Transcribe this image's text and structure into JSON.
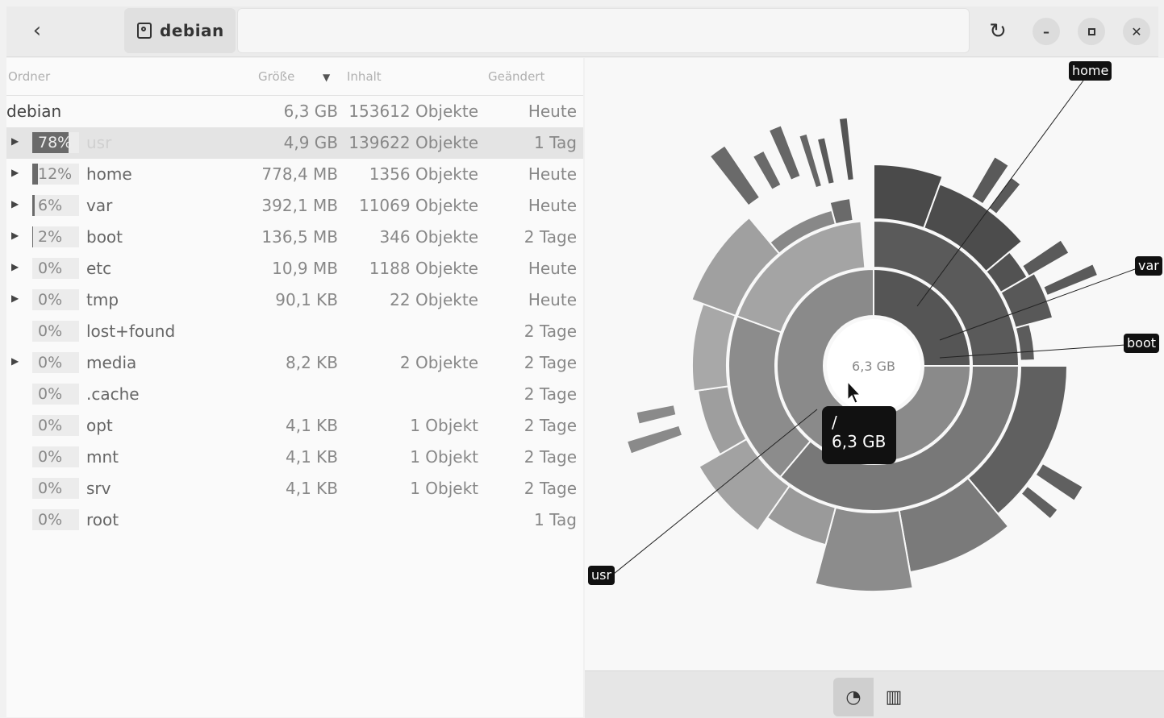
{
  "header": {
    "back_icon": "chevron-left-icon",
    "breadcrumb": "debian",
    "refresh_icon": "refresh-icon",
    "minimize_icon": "minimize-icon",
    "maximize_icon": "maximize-icon",
    "close_icon": "close-icon"
  },
  "columns": {
    "folder": "Ordner",
    "size": "Größe",
    "contents": "Inhalt",
    "modified": "Geändert"
  },
  "root": {
    "name": "debian",
    "size": "6,3 GB",
    "count": "153612 Objekte",
    "modified": "Heute"
  },
  "rows": [
    {
      "pct": "78%",
      "fill": 0.78,
      "name": "usr",
      "size": "4,9 GB",
      "count": "139622 Objekte",
      "modified": "1 Tag",
      "expandable": true,
      "selected": true
    },
    {
      "pct": "12%",
      "fill": 0.12,
      "name": "home",
      "size": "778,4 MB",
      "count": "1356 Objekte",
      "modified": "Heute",
      "expandable": true
    },
    {
      "pct": "6%",
      "fill": 0.06,
      "name": "var",
      "size": "392,1 MB",
      "count": "11069 Objekte",
      "modified": "Heute",
      "expandable": true
    },
    {
      "pct": "2%",
      "fill": 0.02,
      "name": "boot",
      "size": "136,5 MB",
      "count": "346 Objekte",
      "modified": "2 Tage",
      "expandable": true
    },
    {
      "pct": "0%",
      "fill": 0,
      "name": "etc",
      "size": "10,9 MB",
      "count": "1188 Objekte",
      "modified": "Heute",
      "expandable": true
    },
    {
      "pct": "0%",
      "fill": 0,
      "name": "tmp",
      "size": "90,1 KB",
      "count": "22 Objekte",
      "modified": "Heute",
      "expandable": true
    },
    {
      "pct": "0%",
      "fill": 0,
      "name": "lost+found",
      "size": "",
      "count": "",
      "modified": "2 Tage",
      "expandable": false
    },
    {
      "pct": "0%",
      "fill": 0,
      "name": "media",
      "size": "8,2 KB",
      "count": "2 Objekte",
      "modified": "2 Tage",
      "expandable": true
    },
    {
      "pct": "0%",
      "fill": 0,
      "name": ".cache",
      "size": "",
      "count": "",
      "modified": "2 Tage",
      "expandable": false
    },
    {
      "pct": "0%",
      "fill": 0,
      "name": "opt",
      "size": "4,1 KB",
      "count": "1 Objekt",
      "modified": "2 Tage",
      "expandable": false
    },
    {
      "pct": "0%",
      "fill": 0,
      "name": "mnt",
      "size": "4,1 KB",
      "count": "1 Objekt",
      "modified": "2 Tage",
      "expandable": false
    },
    {
      "pct": "0%",
      "fill": 0,
      "name": "srv",
      "size": "4,1 KB",
      "count": "1 Objekt",
      "modified": "2 Tage",
      "expandable": false
    },
    {
      "pct": "0%",
      "fill": 0,
      "name": "root",
      "size": "",
      "count": "",
      "modified": "1 Tag",
      "expandable": false
    }
  ],
  "chart": {
    "center_label": "6,3 GB",
    "tooltip_path": "/",
    "tooltip_size": "6,3 GB",
    "labels": {
      "home": "home",
      "var": "var",
      "boot": "boot",
      "usr": "usr"
    }
  },
  "bottom": {
    "rings_icon": "rings-chart-icon",
    "treemap_icon": "treemap-chart-icon"
  },
  "chart_data": {
    "type": "sunburst",
    "root": {
      "name": "/",
      "value_gb": 6.3
    },
    "children": [
      {
        "name": "usr",
        "share": 0.78
      },
      {
        "name": "home",
        "share": 0.12
      },
      {
        "name": "var",
        "share": 0.06
      },
      {
        "name": "boot",
        "share": 0.02
      },
      {
        "name": "etc",
        "share": 0.0
      },
      {
        "name": "tmp",
        "share": 0.0
      }
    ]
  },
  "colors": {
    "usr": "#8a8a8a",
    "home": "#555555",
    "var": "#4d4d4d",
    "boot": "#606060",
    "ring_stroke": "#f8f8f8"
  }
}
